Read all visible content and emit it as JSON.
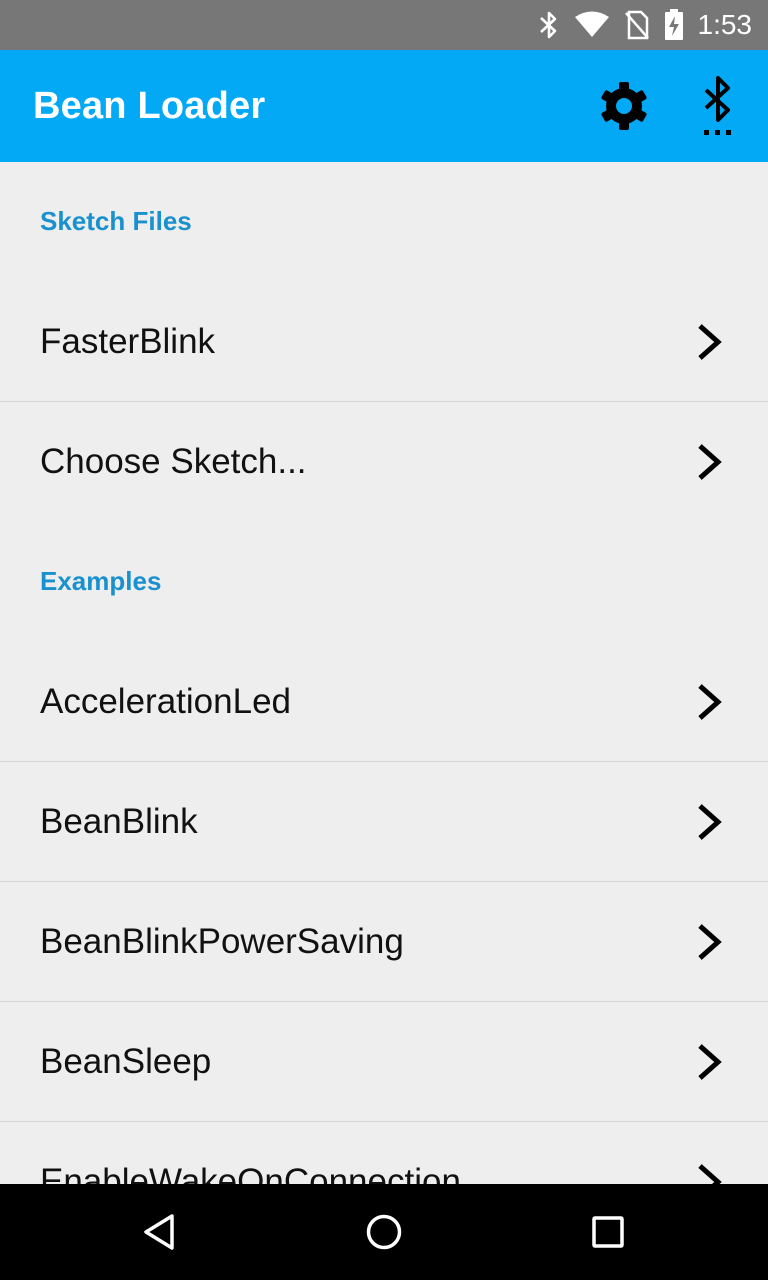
{
  "status_bar": {
    "time": "1:53",
    "icons": [
      "bluetooth-icon",
      "wifi-icon",
      "no-sim-icon",
      "battery-charging-icon"
    ]
  },
  "app_bar": {
    "title": "Bean Loader",
    "actions": [
      "settings-icon",
      "bluetooth-searching-icon"
    ]
  },
  "sections": [
    {
      "header": "Sketch Files",
      "items": [
        "FasterBlink",
        "Choose Sketch..."
      ]
    },
    {
      "header": "Examples",
      "items": [
        "AccelerationLed",
        "BeanBlink",
        "BeanBlinkPowerSaving",
        "BeanSleep",
        "EnableWakeOnConnection"
      ]
    }
  ],
  "nav_bar": {
    "buttons": [
      "back-icon",
      "home-icon",
      "recents-icon"
    ]
  },
  "colors": {
    "app_bar": "#03a9f4",
    "section_header": "#1a91cf",
    "background": "#eeeeee",
    "status_bar": "#777777"
  }
}
